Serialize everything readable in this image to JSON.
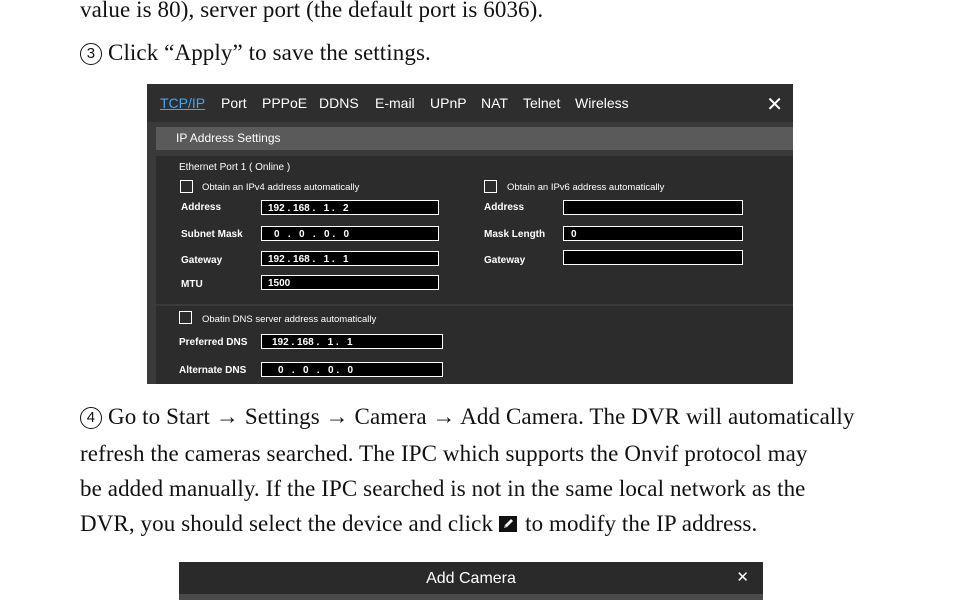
{
  "doc": {
    "line_top": "value is 80), server port (the default port is 6036).",
    "step3_num": "3",
    "step3_text": "Click “Apply” to save the settings.",
    "step4_num": "4",
    "step4_line1": "Go to Start → Settings → Camera → Add Camera. The DVR will automatically",
    "line2": "refresh the cameras searched. The IPC which supports the Onvif protocol may",
    "line3": "be added manually. If the IPC searched is not in the same local network as the",
    "line4_a": "DVR, you should select the device and click",
    "line4_b": "to modify the IP address."
  },
  "net_dialog": {
    "tabs": [
      "TCP/IP",
      "Port",
      "PPPoE",
      "DDNS",
      "E-mail",
      "UPnP",
      "NAT",
      "Telnet",
      "Wireless"
    ],
    "close": "✕",
    "section_title": "IP Address Settings",
    "port_label": "Ethernet Port 1 ( Online )",
    "ipv4_auto": "Obtain an IPv4 address automatically",
    "ipv6_auto": "Obtain an IPv6 address automatically",
    "address_label": "Address",
    "address_value": "192 . 168 .   1 .   2",
    "subnet_label": "Subnet Mask",
    "subnet_value": "0   .   0   .   0 .   0",
    "gateway_label": "Gateway",
    "gateway_value": "192 . 168 .   1 .   1",
    "mtu_label": "MTU",
    "mtu_value": "1500",
    "v6_address_label": "Address",
    "v6_address_value": "",
    "mask_length_label": "Mask Length",
    "mask_length_value": "0",
    "v6_gateway_label": "Gateway",
    "v6_gateway_value": "",
    "dns_auto": "Obatin DNS server address automatically",
    "pref_dns_label": "Preferred DNS",
    "pref_dns_value": "192 . 168 .   1 .   1",
    "alt_dns_label": "Alternate DNS",
    "alt_dns_value": "0   .   0   .   0 .   0"
  },
  "add_camera_dialog": {
    "title": "Add Camera",
    "close": "✕"
  }
}
